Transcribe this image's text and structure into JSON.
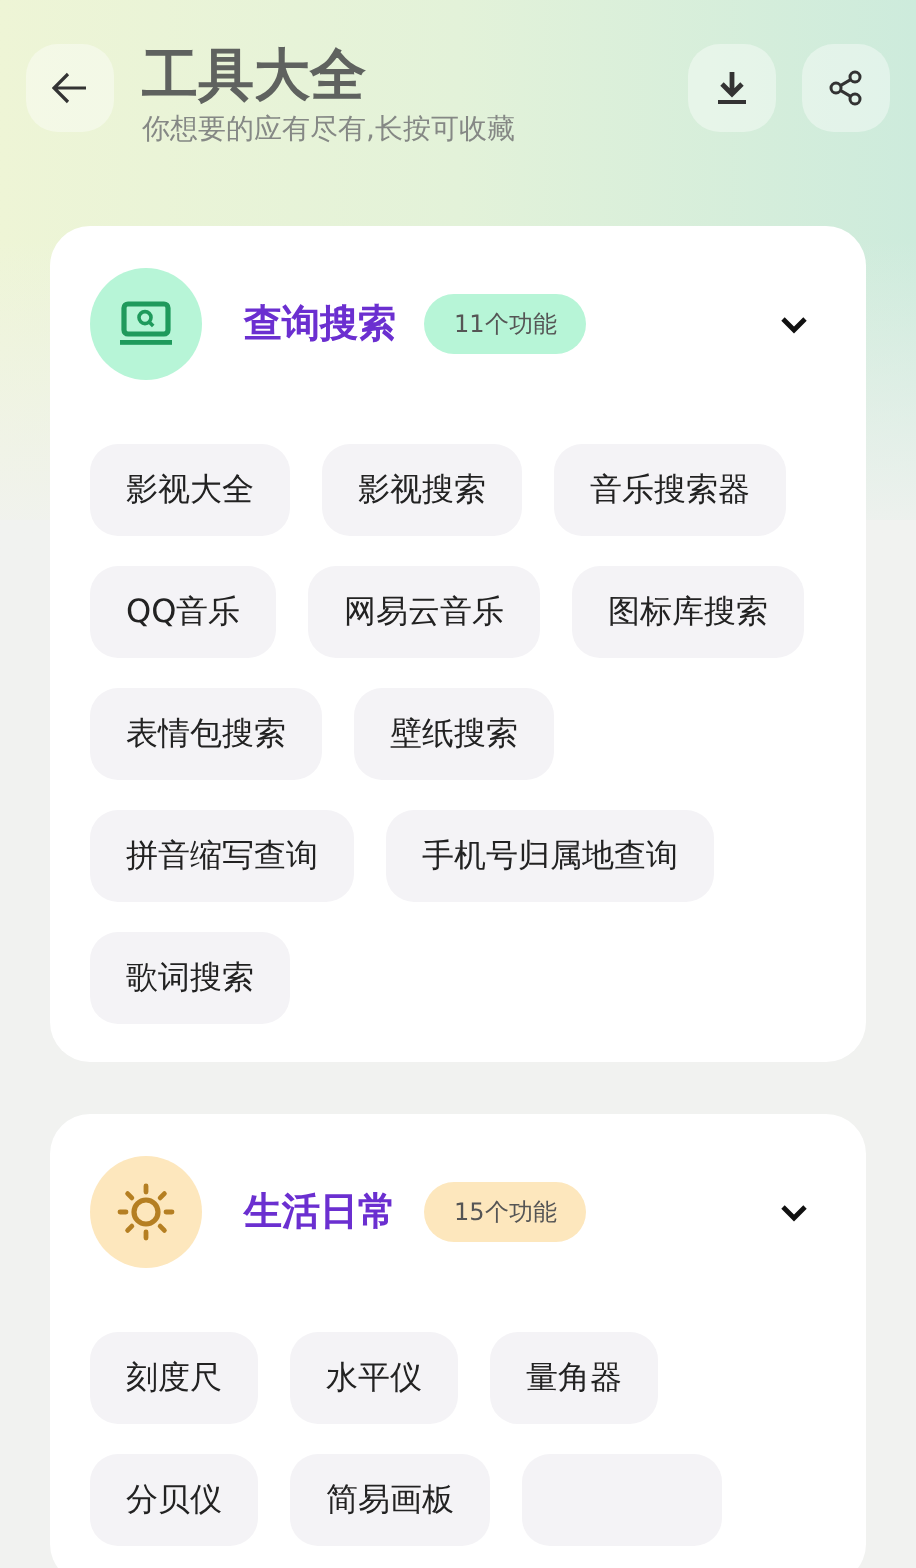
{
  "header": {
    "title": "工具大全",
    "subtitle": "你想要的应有尽有,长按可收藏"
  },
  "categories": [
    {
      "title": "查询搜索",
      "count": "11个功能",
      "kind": "search",
      "expanded": true,
      "color": "#b7f5d7",
      "items": [
        {
          "kind": "chip",
          "label": "影视大全"
        },
        {
          "kind": "chip",
          "label": "影视搜索"
        },
        {
          "kind": "chip",
          "label": "音乐搜索器"
        },
        {
          "kind": "chip",
          "label": "QQ音乐"
        },
        {
          "kind": "chip",
          "label": "网易云音乐"
        },
        {
          "kind": "chip",
          "label": "图标库搜索"
        },
        {
          "kind": "chip",
          "label": "表情包搜索"
        },
        {
          "kind": "chip",
          "label": "壁纸搜索"
        },
        {
          "kind": "chip",
          "label": "拼音缩写查询"
        },
        {
          "kind": "chip",
          "label": "手机号归属地查询"
        },
        {
          "kind": "chip",
          "label": "歌词搜索"
        }
      ]
    },
    {
      "title": "生活日常",
      "count": "15个功能",
      "kind": "sun",
      "expanded": true,
      "color": "#fde7bd",
      "items": [
        {
          "kind": "chip",
          "label": "刻度尺"
        },
        {
          "kind": "chip",
          "label": "水平仪"
        },
        {
          "kind": "chip",
          "label": "量角器"
        },
        {
          "kind": "chip",
          "label": "分贝仪"
        },
        {
          "kind": "chip",
          "label": "简易画板"
        },
        {
          "kind": "blank"
        }
      ]
    }
  ]
}
